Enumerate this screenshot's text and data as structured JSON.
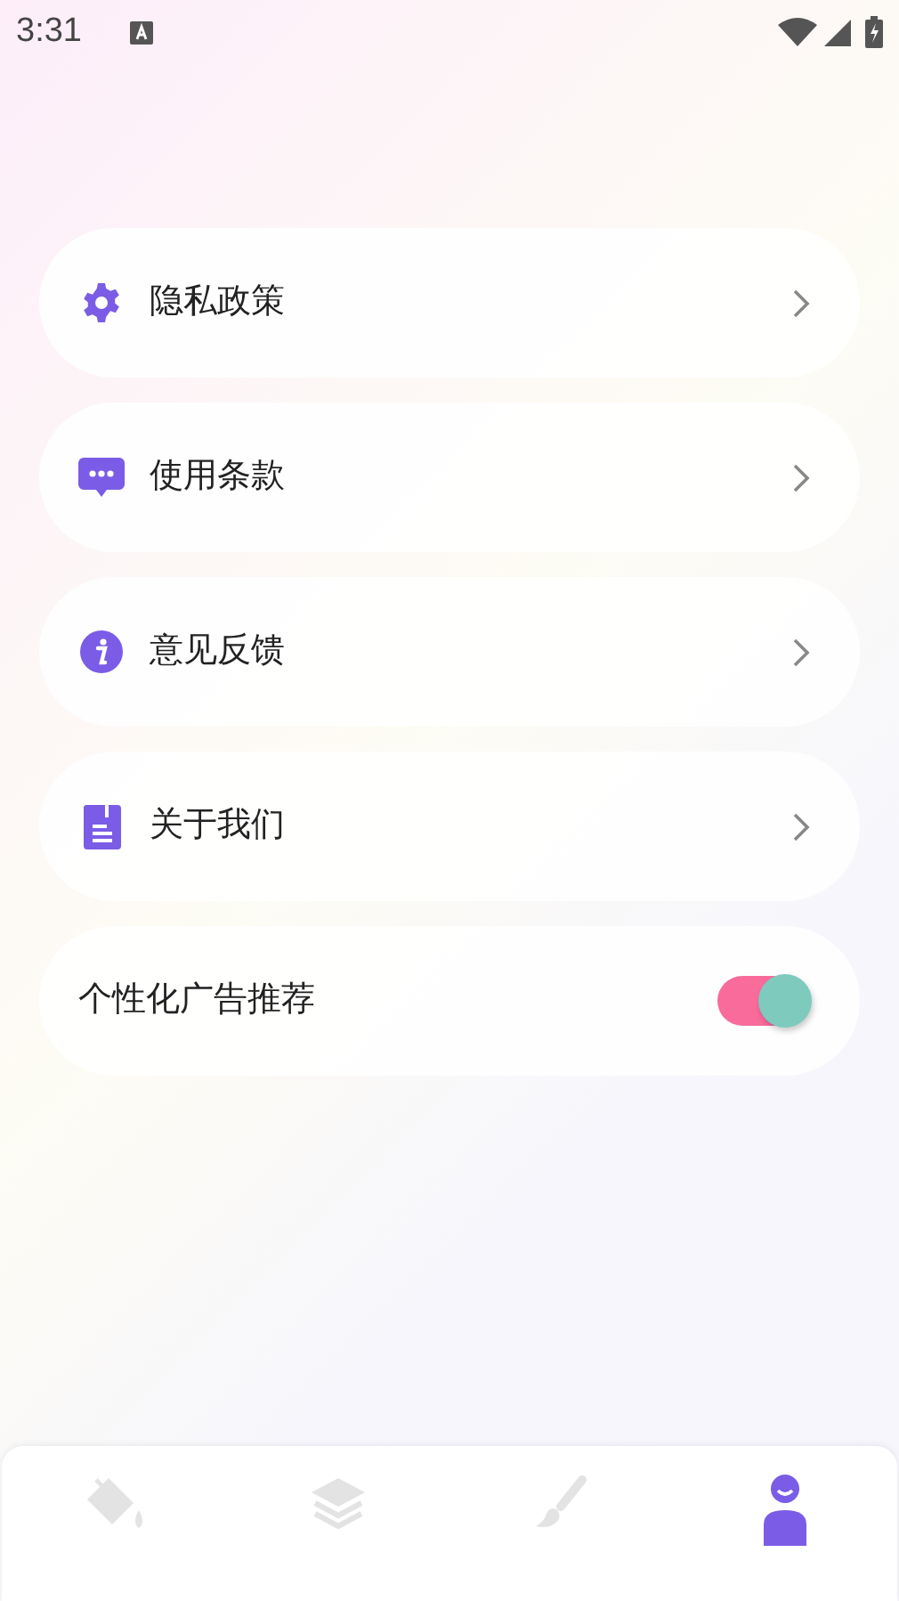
{
  "status_bar": {
    "time": "3:31"
  },
  "menu": [
    {
      "kind": "link",
      "label": "隐私政策"
    },
    {
      "kind": "link",
      "label": "使用条款"
    },
    {
      "kind": "link",
      "label": "意见反馈"
    },
    {
      "kind": "link",
      "label": "关于我们"
    },
    {
      "kind": "toggle",
      "label": "个性化广告推荐",
      "on": true
    }
  ],
  "bottom_nav": [
    {
      "selected": false
    },
    {
      "selected": false
    },
    {
      "selected": false
    },
    {
      "selected": true
    }
  ]
}
